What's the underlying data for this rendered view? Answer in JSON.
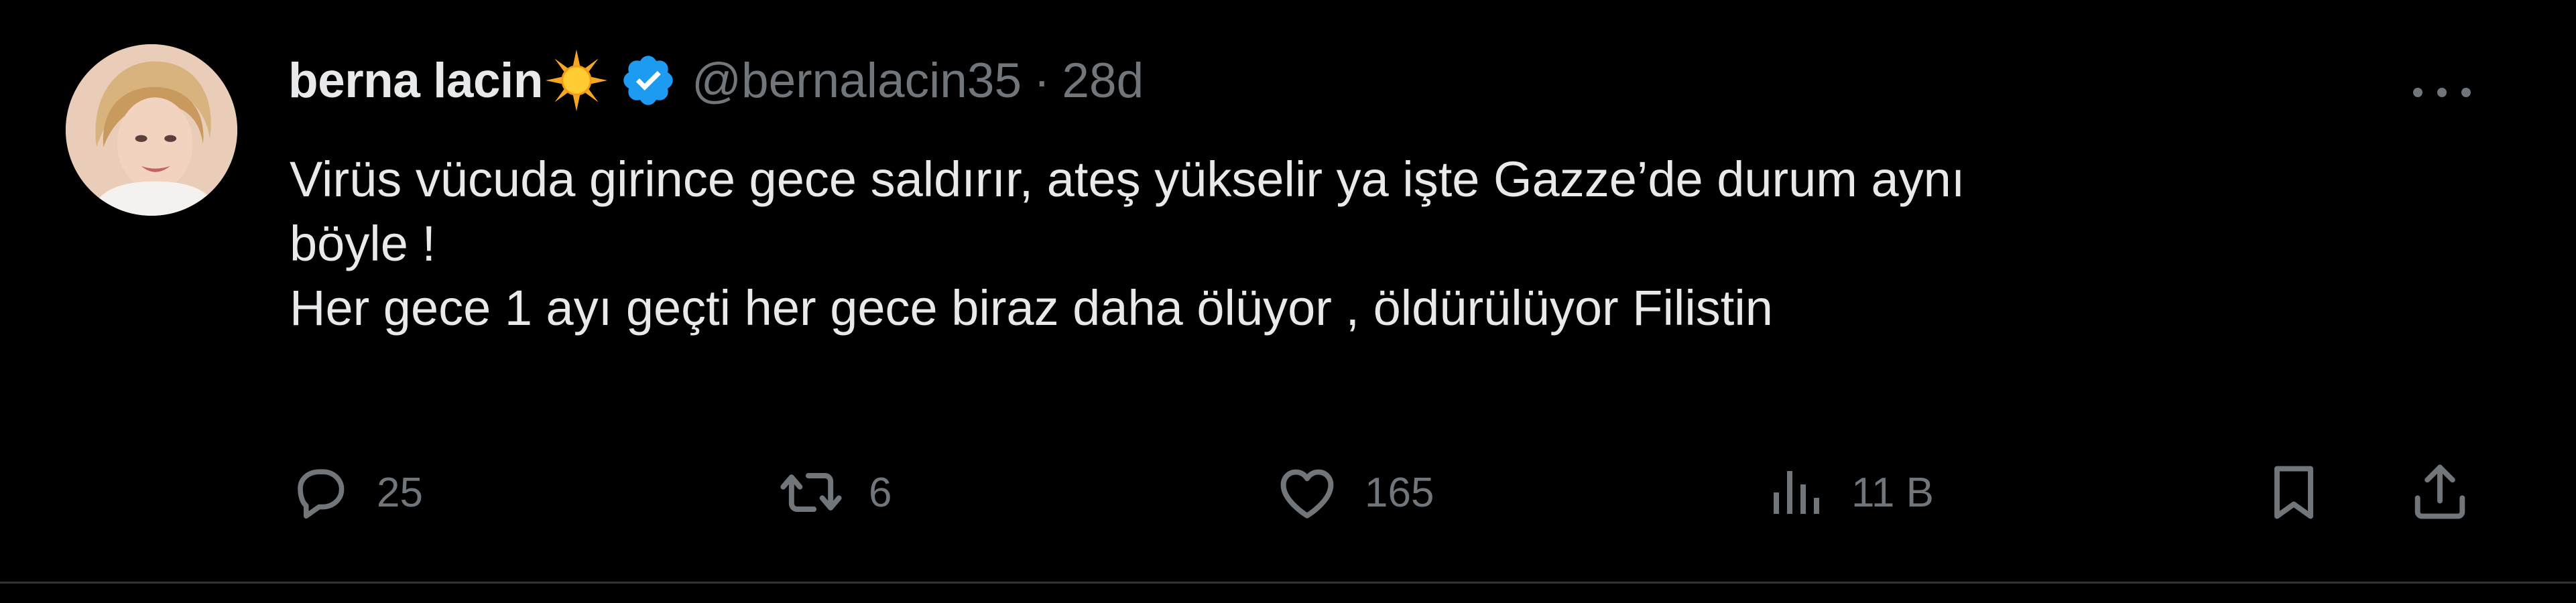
{
  "tweet": {
    "display_name": "berna lacin",
    "name_emoji": "sun-emoji",
    "verified_icon": "verified-badge-icon",
    "handle": "@bernalacin35",
    "separator": "·",
    "time": "28d",
    "text_lines": [
      "Virüs vücuda girince gece saldırır, ateş yükselir ya işte Gazze’de durum aynı",
      "böyle !",
      "Her gece 1 ayı geçti her gece biraz daha ölüyor , öldürülüyor Filistin"
    ]
  },
  "actions": {
    "reply": {
      "icon": "reply-icon",
      "count": "25"
    },
    "retweet": {
      "icon": "retweet-icon",
      "count": "6"
    },
    "like": {
      "icon": "heart-icon",
      "count": "165"
    },
    "views": {
      "icon": "views-icon",
      "count": "11 B"
    },
    "bookmark": {
      "icon": "bookmark-icon"
    },
    "share": {
      "icon": "share-icon"
    }
  },
  "colors": {
    "background": "#000000",
    "primary_text": "#e7e9ea",
    "secondary_text": "#71767b",
    "verified_blue": "#1d9bf0",
    "divider": "#2f3336"
  }
}
